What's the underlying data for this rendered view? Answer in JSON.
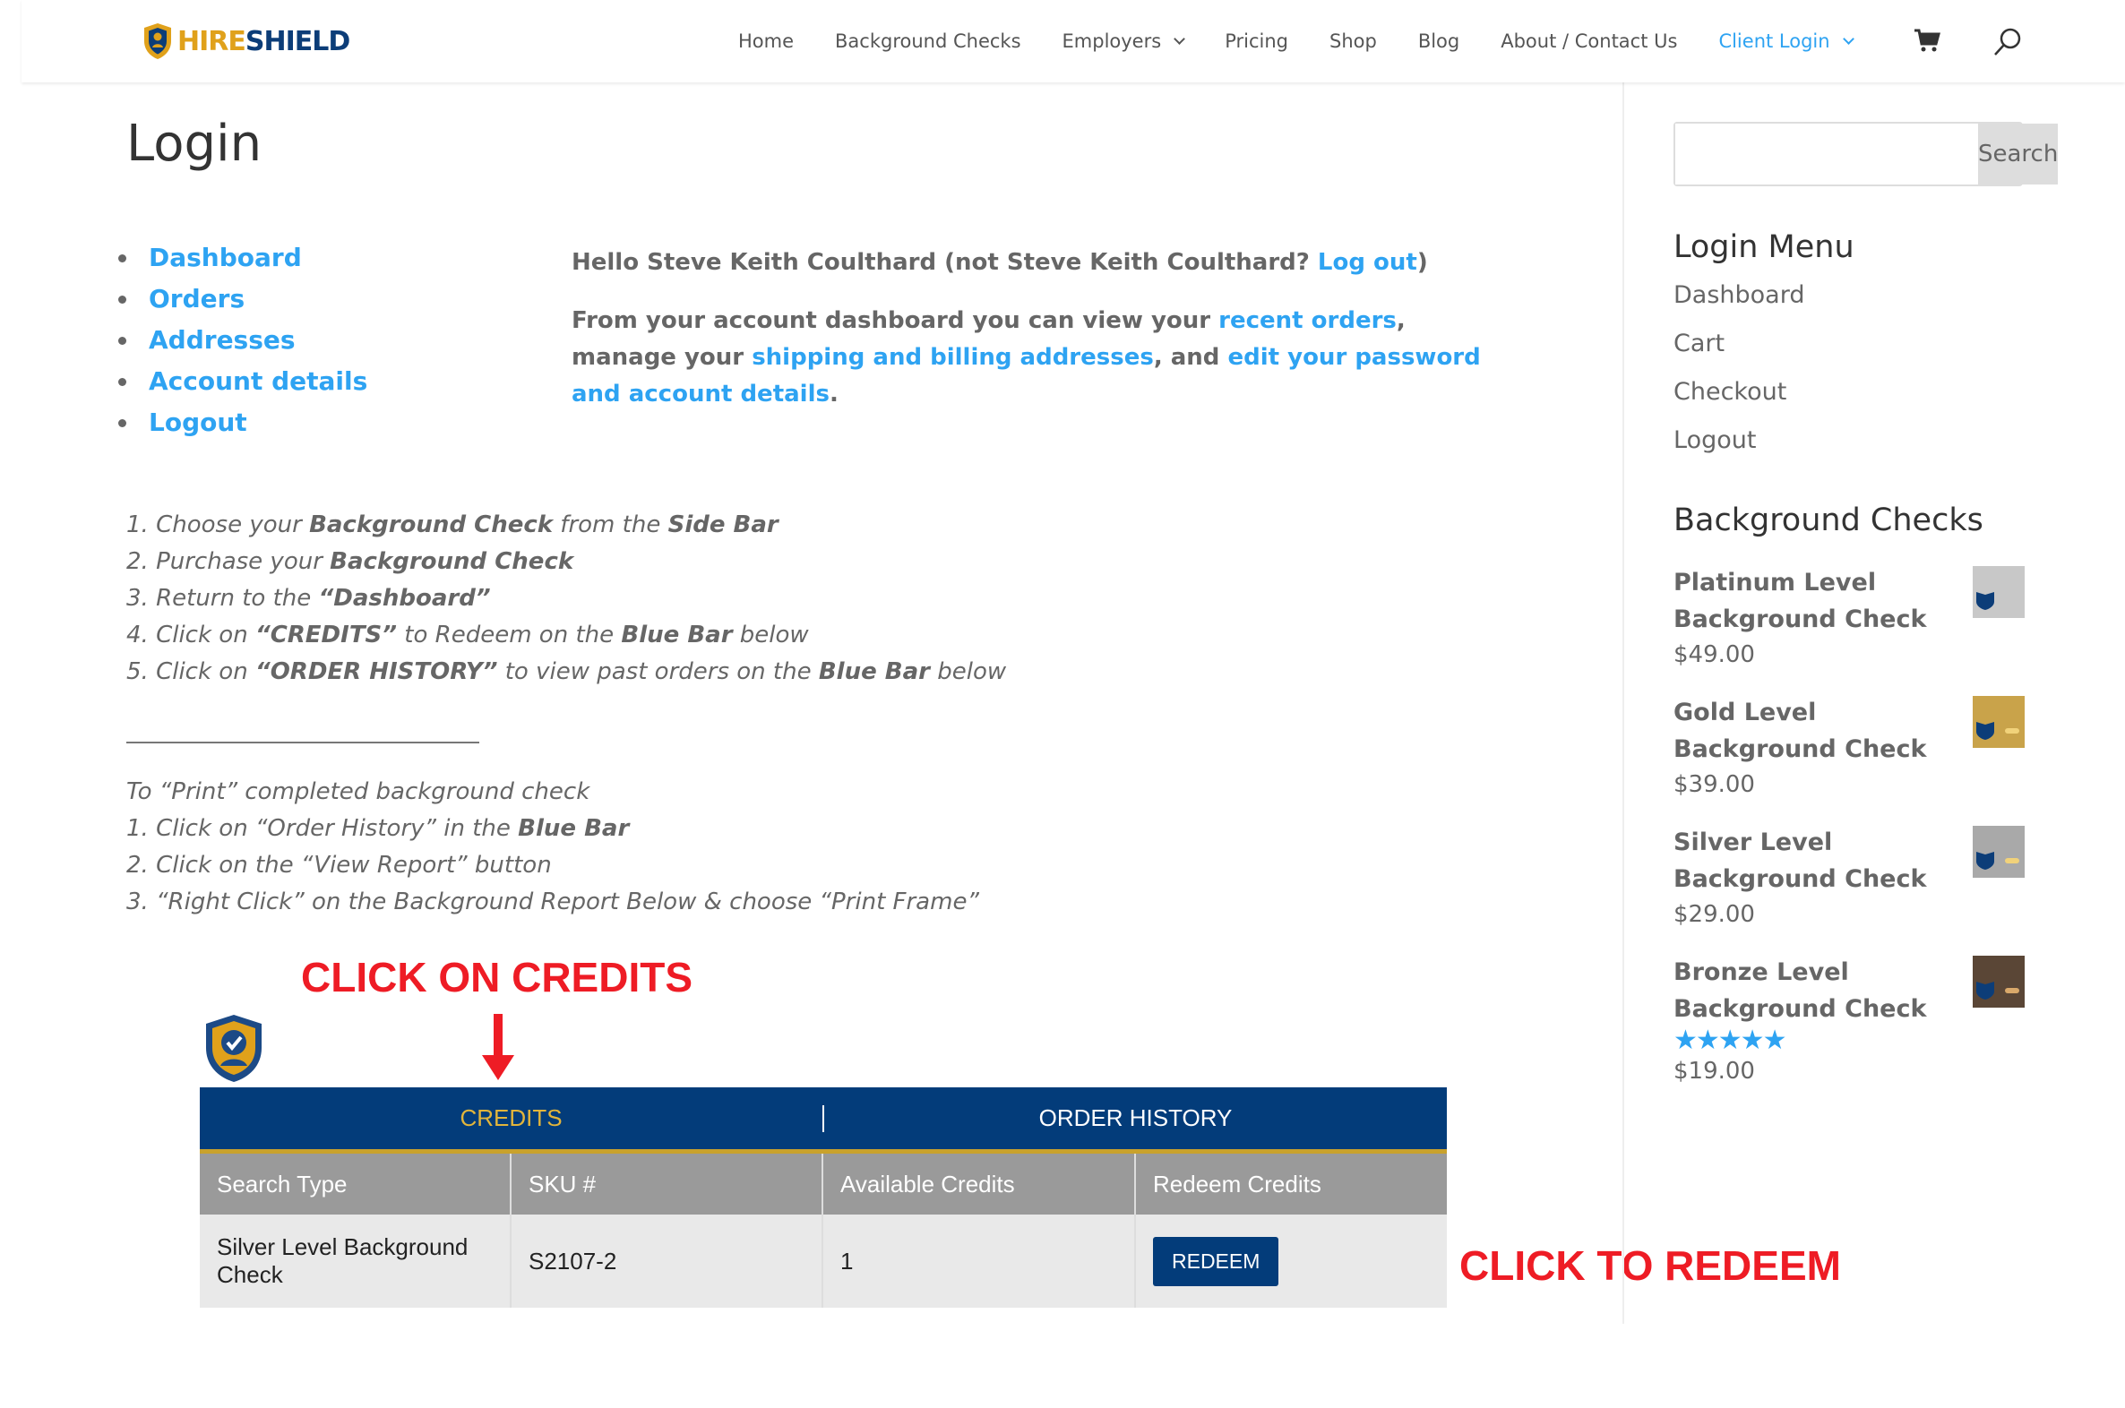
{
  "brand": {
    "hire": "HIRE",
    "shield": "SHIELD"
  },
  "nav": {
    "home": "Home",
    "background_checks": "Background Checks",
    "employers": "Employers",
    "pricing": "Pricing",
    "shop": "Shop",
    "blog": "Blog",
    "about_contact": "About / Contact Us",
    "client_login": "Client Login"
  },
  "page_title": "Login",
  "account_nav": [
    "Dashboard",
    "Orders",
    "Addresses",
    "Account details",
    "Logout"
  ],
  "greeting": {
    "prefix": "Hello Steve Keith Coulthard (not Steve Keith Coulthard? ",
    "logout_link": "Log out",
    "suffix": ")"
  },
  "dashboard_text": {
    "part1": "From your account dashboard you can view your ",
    "link1": "recent orders",
    "part2": ", manage your ",
    "link2": "shipping and billing addresses",
    "part3": ", and ",
    "link3": "edit your password and account details",
    "part4": "."
  },
  "steps": {
    "s1a": "1. Choose your ",
    "s1b": "Background Check",
    "s1c": " from the ",
    "s1d": "Side Bar",
    "s2a": "2. Purchase your ",
    "s2b": "Background Check",
    "s3a": "3. Return to the ",
    "s3b": "“Dashboard”",
    "s4a": "4. Click on ",
    "s4b": "“CREDITS”",
    "s4c": " to Redeem on the ",
    "s4d": "Blue Bar",
    "s4e": " below",
    "s5a": "5. Click on ",
    "s5b": "“ORDER HISTORY”",
    "s5c": " to view past orders on the ",
    "s5d": "Blue Bar",
    "s5e": " below"
  },
  "print_steps": {
    "intro": "To “Print” completed background check",
    "p1a": "1. Click on “Order History” in the ",
    "p1b": "Blue Bar",
    "p2": "2. Click on the “View Report” button",
    "p3": "3. “Right Click” on the Background Report Below & choose “Print Frame”"
  },
  "annotations": {
    "credits": "CLICK ON CREDITS",
    "redeem": "CLICK TO REDEEM"
  },
  "bluebar": {
    "credits_tab": "CREDITS",
    "order_history_tab": "ORDER HISTORY"
  },
  "credits_table": {
    "headers": [
      "Search Type",
      "SKU #",
      "Available Credits",
      "Redeem Credits"
    ],
    "rows": [
      {
        "search_type": "Silver Level Background Check",
        "sku": "S2107-2",
        "available": "1",
        "button": "REDEEM"
      }
    ]
  },
  "sidebar": {
    "search_button": "Search",
    "search_placeholder": "",
    "login_menu_title": "Login Menu",
    "login_menu": [
      "Dashboard",
      "Cart",
      "Checkout",
      "Logout"
    ],
    "bg_checks_title": "Background Checks",
    "products": [
      {
        "name": "Platinum Level Background Check",
        "price": "$49.00",
        "thumb_color": "#c8c8c8"
      },
      {
        "name": "Gold Level Background Check",
        "price": "$39.00",
        "thumb_color": "#c9a34a"
      },
      {
        "name": "Silver Level Background Check",
        "price": "$29.00",
        "thumb_color": "#a9a9a9"
      },
      {
        "name": "Bronze Level Background Check",
        "price": "$19.00",
        "thumb_color": "#5a4636",
        "rating": 5
      }
    ]
  },
  "colors": {
    "accent": "#2ea3f2",
    "navy": "#033c7a",
    "gold": "#c9a22c",
    "annotation_red": "#ee1c25"
  }
}
